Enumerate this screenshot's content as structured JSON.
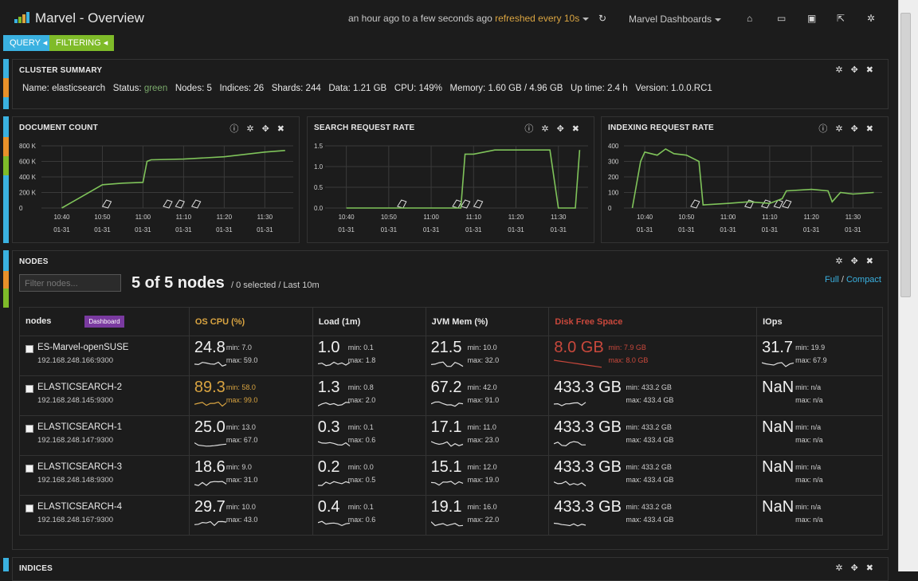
{
  "app": {
    "title": "Marvel - Overview",
    "time_range": "an hour ago to a few seconds ago",
    "refresh": "refreshed every 10s",
    "dashboards_menu": "Marvel Dashboards",
    "colors": {
      "accent": "#3ab1e0",
      "filter": "#7fbb29",
      "warning": "#d9a441",
      "danger": "#c9483c",
      "dashboard_btn": "#7a3aa0"
    }
  },
  "filterbar": {
    "query_label": "QUERY",
    "filtering_label": "FILTERING"
  },
  "cluster_summary": {
    "title": "CLUSTER SUMMARY",
    "name_label": "Name:",
    "name": "elasticsearch",
    "status_label": "Status:",
    "status": "green",
    "nodes_label": "Nodes:",
    "nodes": "5",
    "indices_label": "Indices:",
    "indices": "26",
    "shards_label": "Shards:",
    "shards": "244",
    "data_label": "Data:",
    "data": "1.21 GB",
    "cpu_label": "CPU:",
    "cpu": "149%",
    "memory_label": "Memory:",
    "memory": "1.60 GB / 4.96 GB",
    "uptime_label": "Up time:",
    "uptime": "2.4 h",
    "version_label": "Version:",
    "version": "1.0.0.RC1"
  },
  "chart_data": [
    {
      "type": "line",
      "title": "DOCUMENT COUNT",
      "x_ticks": [
        "10:40",
        "10:50",
        "11:00",
        "11:10",
        "11:20",
        "11:30"
      ],
      "x_tick_sub": "01-31",
      "y_ticks": [
        "0",
        "200 K",
        "400 K",
        "600 K",
        "800 K"
      ],
      "ylim": [
        0,
        800000
      ],
      "annotations": 5,
      "x": [
        "10:40",
        "10:45",
        "10:50",
        "10:55",
        "11:00",
        "11:01",
        "11:02",
        "11:10",
        "11:20",
        "11:30",
        "11:35"
      ],
      "values": [
        0,
        150000,
        300000,
        320000,
        330000,
        600000,
        620000,
        630000,
        660000,
        720000,
        740000
      ]
    },
    {
      "type": "line",
      "title": "SEARCH REQUEST RATE",
      "x_ticks": [
        "10:40",
        "10:50",
        "11:00",
        "11:10",
        "11:20",
        "11:30"
      ],
      "x_tick_sub": "01-31",
      "y_ticks": [
        "0.0",
        "0.5",
        "1.0",
        "1.5"
      ],
      "ylim": [
        0,
        1.5
      ],
      "annotations": 4,
      "x": [
        "10:40",
        "10:50",
        "11:00",
        "11:07",
        "11:08",
        "11:10",
        "11:15",
        "11:20",
        "11:28",
        "11:30",
        "11:32",
        "11:34",
        "11:35"
      ],
      "values": [
        0,
        0,
        0,
        0,
        1.3,
        1.3,
        1.4,
        1.4,
        1.4,
        0,
        0,
        0,
        1.4
      ]
    },
    {
      "type": "line",
      "title": "INDEXING REQUEST RATE",
      "x_ticks": [
        "10:40",
        "10:50",
        "11:00",
        "11:10",
        "11:20",
        "11:30"
      ],
      "x_tick_sub": "01-31",
      "y_ticks": [
        "0",
        "100",
        "200",
        "300",
        "400"
      ],
      "ylim": [
        0,
        400
      ],
      "annotations": 5,
      "x": [
        "10:37",
        "10:39",
        "10:40",
        "10:43",
        "10:45",
        "10:47",
        "10:50",
        "10:53",
        "10:54",
        "11:00",
        "11:05",
        "11:10",
        "11:13",
        "11:14",
        "11:20",
        "11:24",
        "11:25",
        "11:27",
        "11:30",
        "11:35"
      ],
      "values": [
        0,
        300,
        360,
        340,
        380,
        350,
        340,
        300,
        20,
        30,
        40,
        30,
        60,
        110,
        120,
        110,
        40,
        100,
        90,
        100
      ]
    }
  ],
  "nodes": {
    "title": "NODES",
    "filter_placeholder": "Filter nodes...",
    "count_big": "5 of 5 nodes",
    "count_small": "/ 0 selected / Last 10m",
    "full_label": "Full",
    "compact_label": "Compact",
    "separator": "/",
    "headers": {
      "nodes": "nodes",
      "dashboard": "Dashboard",
      "cpu": "OS CPU (%)",
      "load": "Load (1m)",
      "jvm": "JVM Mem (%)",
      "disk": "Disk Free Space",
      "iops": "IOps"
    },
    "rows": [
      {
        "name": "ES-Marvel-openSUSE",
        "ip": "192.168.248.166:9300",
        "cpu": {
          "v": "24.8",
          "min": "min: 7.0",
          "max": "max: 59.0"
        },
        "load": {
          "v": "1.0",
          "min": "min: 0.1",
          "max": "max: 1.8"
        },
        "jvm": {
          "v": "21.5",
          "min": "min: 10.0",
          "max": "max: 32.0"
        },
        "disk": {
          "v": "8.0 GB",
          "min": "min: 7.9 GB",
          "max": "max: 8.0 GB"
        },
        "iops": {
          "v": "31.7",
          "min": "min: 19.9",
          "max": "max: 67.9"
        }
      },
      {
        "name": "ELASTICSEARCH-2",
        "ip": "192.168.248.145:9300",
        "cpu": {
          "v": "89.3",
          "min": "min: 58.0",
          "max": "max: 99.0"
        },
        "load": {
          "v": "1.3",
          "min": "min: 0.8",
          "max": "max: 2.0"
        },
        "jvm": {
          "v": "67.2",
          "min": "min: 42.0",
          "max": "max: 91.0"
        },
        "disk": {
          "v": "433.3 GB",
          "min": "min: 433.2 GB",
          "max": "max: 433.4 GB"
        },
        "iops": {
          "v": "NaN",
          "min": "min: n/a",
          "max": "max: n/a"
        }
      },
      {
        "name": "ELASTICSEARCH-1",
        "ip": "192.168.248.147:9300",
        "cpu": {
          "v": "25.0",
          "min": "min: 13.0",
          "max": "max: 67.0"
        },
        "load": {
          "v": "0.3",
          "min": "min: 0.1",
          "max": "max: 0.6"
        },
        "jvm": {
          "v": "17.1",
          "min": "min: 11.0",
          "max": "max: 23.0"
        },
        "disk": {
          "v": "433.3 GB",
          "min": "min: 433.2 GB",
          "max": "max: 433.4 GB"
        },
        "iops": {
          "v": "NaN",
          "min": "min: n/a",
          "max": "max: n/a"
        }
      },
      {
        "name": "ELASTICSEARCH-3",
        "ip": "192.168.248.148:9300",
        "cpu": {
          "v": "18.6",
          "min": "min: 9.0",
          "max": "max: 31.0"
        },
        "load": {
          "v": "0.2",
          "min": "min: 0.0",
          "max": "max: 0.5"
        },
        "jvm": {
          "v": "15.1",
          "min": "min: 12.0",
          "max": "max: 19.0"
        },
        "disk": {
          "v": "433.3 GB",
          "min": "min: 433.2 GB",
          "max": "max: 433.4 GB"
        },
        "iops": {
          "v": "NaN",
          "min": "min: n/a",
          "max": "max: n/a"
        }
      },
      {
        "name": "ELASTICSEARCH-4",
        "ip": "192.168.248.167:9300",
        "cpu": {
          "v": "29.7",
          "min": "min: 10.0",
          "max": "max: 43.0"
        },
        "load": {
          "v": "0.4",
          "min": "min: 0.1",
          "max": "max: 0.6"
        },
        "jvm": {
          "v": "19.1",
          "min": "min: 16.0",
          "max": "max: 22.0"
        },
        "disk": {
          "v": "433.3 GB",
          "min": "min: 433.2 GB",
          "max": "max: 433.4 GB"
        },
        "iops": {
          "v": "NaN",
          "min": "min: n/a",
          "max": "max: n/a"
        }
      }
    ]
  },
  "indices": {
    "title": "INDICES"
  }
}
